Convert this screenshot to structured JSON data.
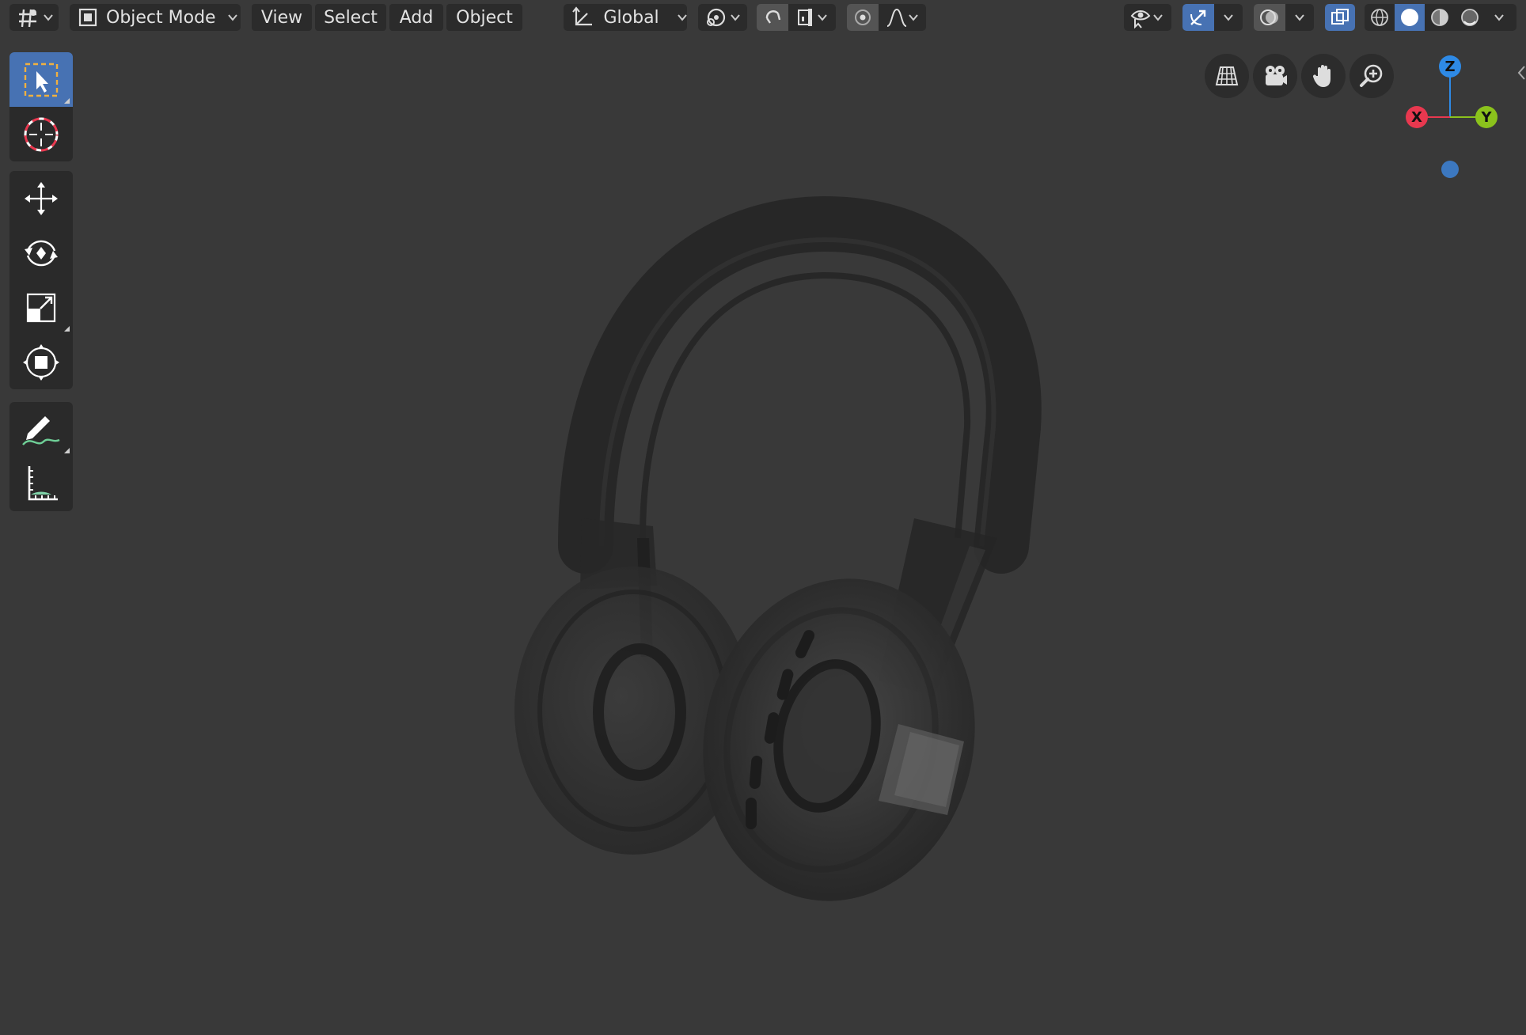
{
  "header": {
    "editor_type_icon": "3d-viewport-icon",
    "mode": {
      "icon": "object-mode-icon",
      "label": "Object Mode"
    },
    "menus": [
      {
        "name": "view",
        "label": "View"
      },
      {
        "name": "select",
        "label": "Select"
      },
      {
        "name": "add",
        "label": "Add"
      },
      {
        "name": "object",
        "label": "Object"
      }
    ],
    "transform_orientation": {
      "icon": "orientation-axes-icon",
      "label": "Global"
    },
    "pivot_icon": "pivot-point-icon",
    "snap_icon": "magnet-icon",
    "snap_target_icon": "snap-increment-icon",
    "proportional_icon": "proportional-edit-icon",
    "falloff_icon": "falloff-curve-icon",
    "right": {
      "visibility_icon": "eye-icon",
      "gizmo_icon": "gizmo-toggle-icon",
      "overlay_icon": "overlays-icon",
      "xray_icon": "xray-toggle-icon",
      "shading_modes": [
        "wireframe-icon",
        "solid-icon",
        "material-preview-icon",
        "rendered-icon"
      ],
      "active_shading": "solid-icon"
    }
  },
  "tools": [
    {
      "name": "select-box-tool",
      "icon": "select-box-icon",
      "active": true
    },
    {
      "name": "cursor-tool",
      "icon": "cursor-icon",
      "active": false
    },
    {
      "name": "move-tool",
      "icon": "move-icon",
      "active": false
    },
    {
      "name": "rotate-tool",
      "icon": "rotate-icon",
      "active": false
    },
    {
      "name": "scale-tool",
      "icon": "scale-icon",
      "active": false
    },
    {
      "name": "transform-tool",
      "icon": "transform-icon",
      "active": false
    },
    {
      "name": "annotate-tool",
      "icon": "annotate-icon",
      "active": false
    },
    {
      "name": "measure-tool",
      "icon": "measure-icon",
      "active": false
    }
  ],
  "navigation": [
    "perspective-grid-icon",
    "camera-icon",
    "hand-pan-icon",
    "zoom-icon"
  ],
  "axis_gizmo": {
    "labels": {
      "x": "X",
      "y": "Y",
      "z": "Z"
    },
    "colors": {
      "x": "#e8384f",
      "y": "#8bc21c",
      "z": "#2e8ae6",
      "neg": "#3c78c0"
    }
  },
  "colors": {
    "viewport_bg": "#393939",
    "button_bg": "#2b2b2b",
    "active_blue": "#4772b3"
  }
}
